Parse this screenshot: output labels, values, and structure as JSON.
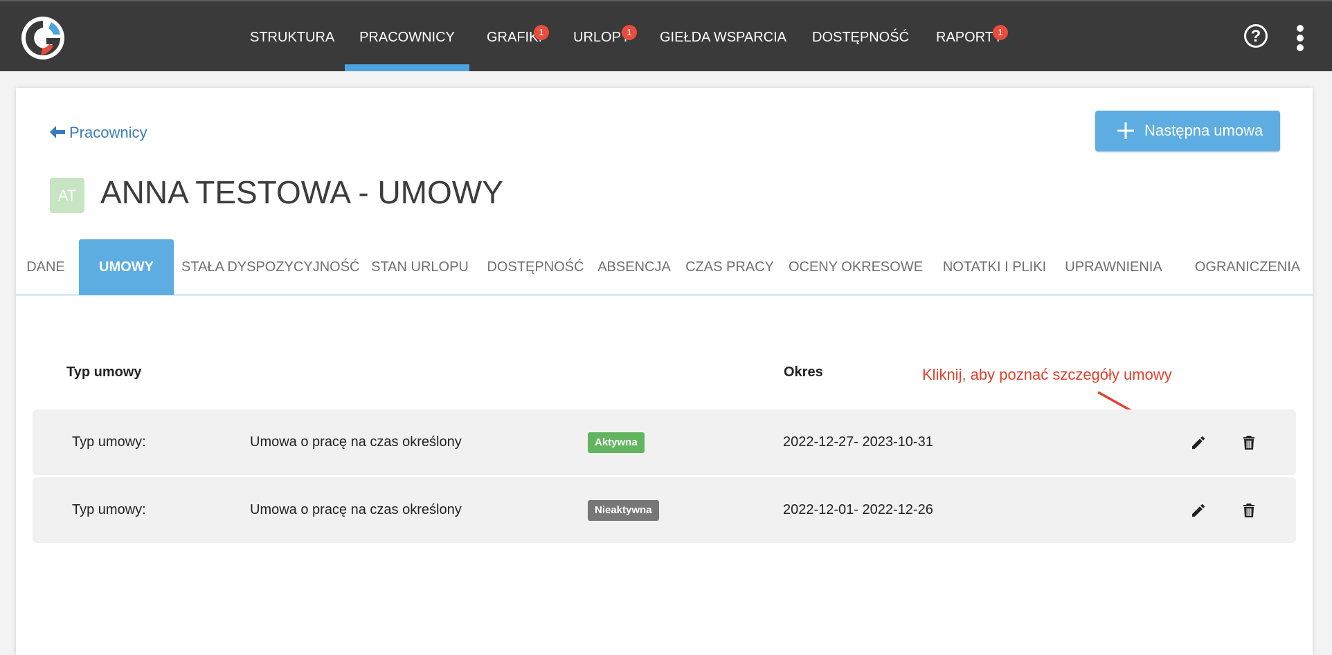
{
  "colors": {
    "topbar": "#3a3a3a",
    "accent": "#5dade2",
    "badge": "#e74c3c",
    "link": "#3a7bbd",
    "status_active": "#62b45e",
    "status_inactive": "#777777",
    "hint": "#e2402c"
  },
  "nav": {
    "items": [
      {
        "label": "STRUKTURA"
      },
      {
        "label": "PRACOWNICY"
      },
      {
        "label": "GRAFIKI",
        "badge": "1"
      },
      {
        "label": "URLOPY",
        "badge": "1"
      },
      {
        "label": "GIEŁDA WSPARCIA"
      },
      {
        "label": "DOSTĘPNOŚĆ"
      },
      {
        "label": "RAPORTY",
        "badge": "1"
      }
    ],
    "help_label": "?",
    "help_icon": "question-circle-icon",
    "menu_icon": "kebab-menu-icon"
  },
  "header": {
    "back_label": "Pracownicy",
    "add_button_label": "Następna umowa",
    "avatar_initials": "AT",
    "title": "ANNA TESTOWA - UMOWY"
  },
  "tabs": [
    {
      "label": "DANE"
    },
    {
      "label": "UMOWY"
    },
    {
      "label": "STAŁA DYSPOZYCYJNOŚĆ"
    },
    {
      "label": "STAN URLOPU"
    },
    {
      "label": "DOSTĘPNOŚĆ"
    },
    {
      "label": "ABSENCJA"
    },
    {
      "label": "CZAS PRACY"
    },
    {
      "label": "OCENY OKRESOWE"
    },
    {
      "label": "NOTATKI I PLIKI"
    },
    {
      "label": "UPRAWNIENIA"
    },
    {
      "label": "OGRANICZENIA"
    }
  ],
  "active_tab": "UMOWY",
  "table": {
    "headers": {
      "type": "Typ umowy",
      "period": "Okres"
    },
    "hint": "Kliknij, aby poznać szczegóły umowy",
    "rows": [
      {
        "type_label": "Typ umowy:",
        "type_value": "Umowa o pracę na czas określony",
        "status": "Aktywna",
        "period": "2022-12-27- 2023-10-31"
      },
      {
        "type_label": "Typ umowy:",
        "type_value": "Umowa o pracę na czas określony",
        "status": "Nieaktywna",
        "period": "2022-12-01- 2022-12-26"
      }
    ]
  }
}
